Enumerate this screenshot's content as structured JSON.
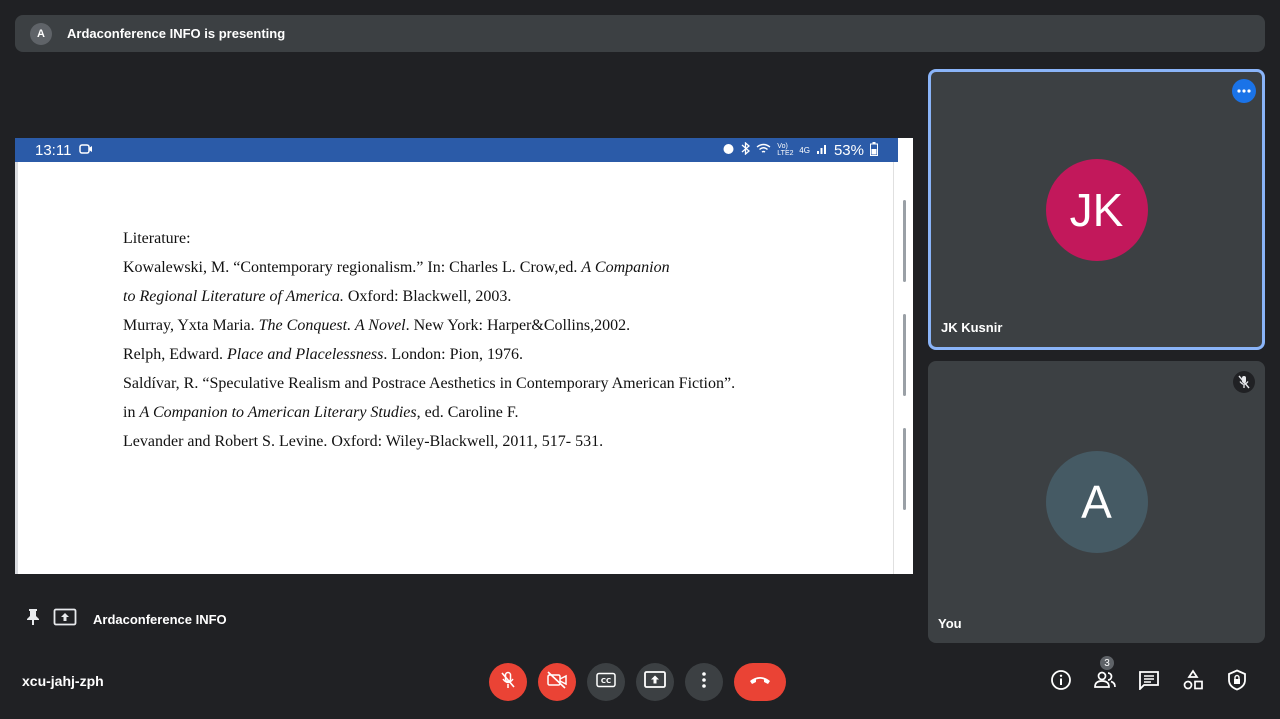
{
  "banner": {
    "avatar_letter": "A",
    "text": "Ardaconference INFO is presenting"
  },
  "phone_status": {
    "time": "13:11",
    "battery": "53%",
    "net": "Vo) LTE2",
    "gen": "4G"
  },
  "document": {
    "lines": [
      [
        "Literature:"
      ],
      [
        "Kowalewski, M. “Contemporary regionalism.” In: Charles L. Crow,ed. ",
        "A Companion"
      ],
      [
        "to Regional Literature of America.",
        " Oxford: Blackwell, 2003."
      ],
      [
        "Murray, Yxta Maria. ",
        "The Conquest. A Novel",
        ". New York: Harper&Collins,2002."
      ],
      [
        "Relph, Edward. ",
        "Place and Placelessness",
        ". London: Pion, 1976."
      ],
      [
        "Saldívar, R. “Speculative Realism and Postrace Aesthetics in Contemporary American Fiction”."
      ],
      [
        "in ",
        "A Companion to American Literary Studies",
        ", ed. Caroline F."
      ],
      [
        "Levander and Robert S. Levine. Oxford: Wiley-Blackwell, 2011, 517- 531."
      ]
    ]
  },
  "presenter_row": {
    "label": "Ardaconference INFO"
  },
  "tiles": {
    "jk": {
      "initials": "JK",
      "name": "JK Kusnir",
      "color": "#c2185b"
    },
    "you": {
      "initials": "A",
      "name": "You",
      "color": "#455a64"
    }
  },
  "meeting_code": "xcu-jahj-zph",
  "controls": {
    "mic": "mic-off-icon",
    "cam": "camera-off-icon",
    "cc": "CC",
    "present": "present-icon",
    "more": "more-vert-icon",
    "hangup": "hangup-icon"
  },
  "right_controls": {
    "people_count": "3"
  }
}
